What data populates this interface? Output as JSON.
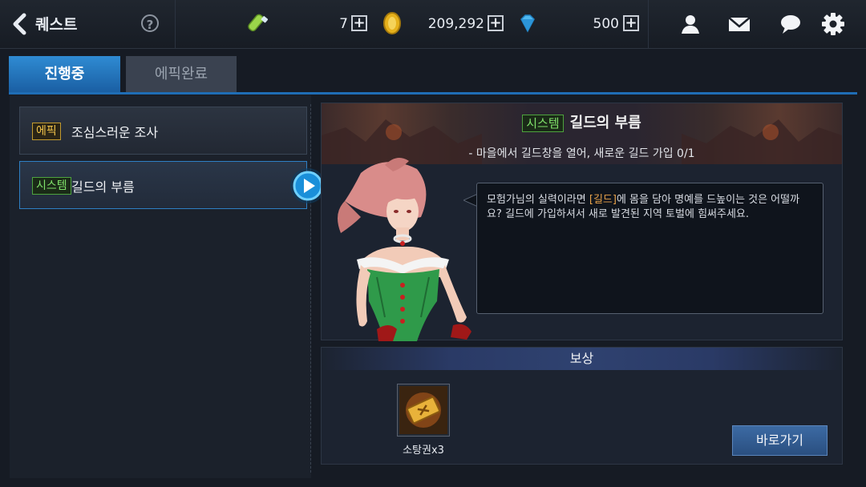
{
  "header": {
    "title": "퀘스트",
    "help_label": "?",
    "resources": [
      {
        "name": "fatigue",
        "icon": "potion-icon",
        "value": "7"
      },
      {
        "name": "gold",
        "icon": "gold-coin-icon",
        "value": "209,292"
      },
      {
        "name": "gem",
        "icon": "diamond-icon",
        "value": "500"
      }
    ],
    "plus_label": "+",
    "actions": [
      "friends-icon",
      "mail-icon",
      "chat-icon",
      "settings-icon"
    ]
  },
  "tabs": [
    {
      "label": "진행중",
      "active": true
    },
    {
      "label": "에픽완료",
      "active": false
    }
  ],
  "quests": [
    {
      "tag": "에픽",
      "name": "조심스러운 조사",
      "selected": false
    },
    {
      "tag": "시스템",
      "name": "길드의 부름",
      "selected": true
    }
  ],
  "detail": {
    "tag": "시스템",
    "title": "길드의 부름",
    "objective": "- 마을에서 길드창을 열어, 새로운 길드 가입 0/1",
    "dialogue_pre": "모험가님의 실력이라면 ",
    "dialogue_highlight": "[길드]",
    "dialogue_post": "에 몸을 담아 명예를 드높이는 것은 어떨까요?  길드에 가입하셔서 새로 발견된 지역 토벌에 힘써주세요."
  },
  "reward": {
    "header": "보상",
    "item_label": "소탕권x3",
    "item_icon": "ticket-icon",
    "go_button": "바로가기"
  },
  "colors": {
    "accent": "#2f8bd3",
    "epic_tag": "#f0c24a",
    "system_tag": "#7fe06a",
    "highlight": "#e8a24a"
  }
}
